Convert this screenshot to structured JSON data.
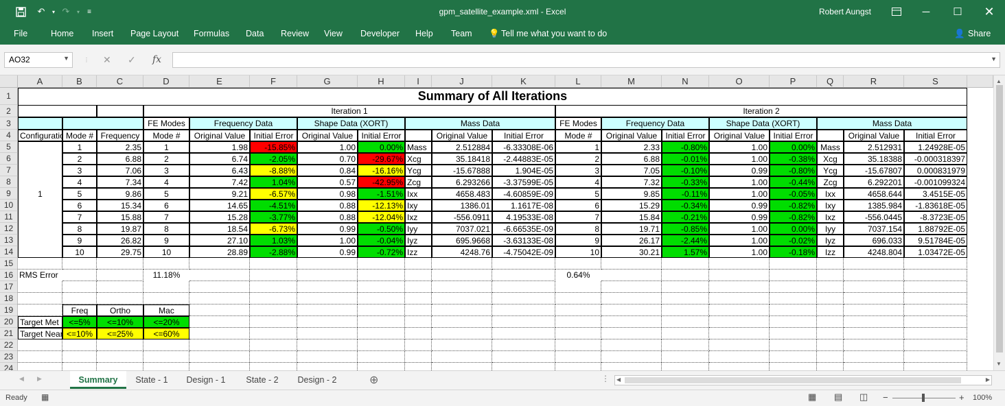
{
  "window": {
    "title": "gpm_satellite_example.xml  -  Excel",
    "user": "Robert Aungst"
  },
  "titlebar_icons": {
    "save": "save-icon",
    "undo": "undo-icon",
    "redo": "redo-icon",
    "customize": "customize-qat-icon"
  },
  "menu": {
    "items": [
      "File",
      "Home",
      "Insert",
      "Page Layout",
      "Formulas",
      "Data",
      "Review",
      "View",
      "Developer",
      "Help",
      "Team"
    ],
    "tell_me": "Tell me what you want to do",
    "share": "Share"
  },
  "formula_bar": {
    "namebox": "AO32",
    "formula": "",
    "fx": "fx"
  },
  "columns": [
    "A",
    "B",
    "C",
    "D",
    "E",
    "F",
    "G",
    "H",
    "I",
    "J",
    "K",
    "L",
    "M",
    "N",
    "O",
    "P",
    "Q",
    "R",
    "S"
  ],
  "rows": [
    "1",
    "2",
    "3",
    "4",
    "5",
    "6",
    "7",
    "8",
    "9",
    "10",
    "11",
    "12",
    "13",
    "14",
    "15",
    "16",
    "17",
    "18",
    "19",
    "20",
    "21",
    "22",
    "23",
    "24"
  ],
  "sheet": {
    "title": "Summary of All Iterations",
    "iteration1": "Iteration 1",
    "iteration2": "Iteration 2",
    "fe_modes": "FE Modes",
    "frequency_data": "Frequency Data",
    "shape_data": "Shape Data (XORT)",
    "mass_data": "Mass Data",
    "hdr_configuration": "Configuration",
    "hdr_mode": "Mode #",
    "hdr_frequency": "Frequency",
    "hdr_original": "Original Value",
    "hdr_initial_error": "Initial Error",
    "config_value": "1",
    "modes": [
      "1",
      "2",
      "3",
      "4",
      "5",
      "6",
      "7",
      "8",
      "9",
      "10"
    ],
    "frequencies": [
      "2.35",
      "6.88",
      "7.06",
      "7.34",
      "9.86",
      "15.34",
      "15.88",
      "19.87",
      "26.82",
      "29.75"
    ],
    "it1": {
      "freq_orig": [
        "1.98",
        "6.74",
        "6.43",
        "7.42",
        "9.21",
        "14.65",
        "15.28",
        "18.54",
        "27.10",
        "28.89"
      ],
      "freq_err": [
        "-15.85%",
        "-2.05%",
        "-8.88%",
        "1.04%",
        "-6.57%",
        "-4.51%",
        "-3.77%",
        "-6.73%",
        "1.03%",
        "-2.88%"
      ],
      "freq_color": [
        "red",
        "green",
        "yellow",
        "green",
        "yellow",
        "green",
        "green",
        "yellow",
        "green",
        "green"
      ],
      "shape_orig": [
        "1.00",
        "0.70",
        "0.84",
        "0.57",
        "0.98",
        "0.88",
        "0.88",
        "0.99",
        "1.00",
        "0.99"
      ],
      "shape_err": [
        "0.00%",
        "-29.67%",
        "-16.16%",
        "-42.95%",
        "-1.51%",
        "-12.13%",
        "-12.04%",
        "-0.50%",
        "-0.04%",
        "-0.72%"
      ],
      "shape_color": [
        "green",
        "red",
        "yellow",
        "red",
        "green",
        "yellow",
        "yellow",
        "green",
        "green",
        "green"
      ],
      "mass_labels": [
        "Mass",
        "Xcg",
        "Ycg",
        "Zcg",
        "Ixx",
        "Ixy",
        "Ixz",
        "Iyy",
        "Iyz",
        "Izz"
      ],
      "mass_orig": [
        "2.512884",
        "35.18418",
        "-15.67888",
        "6.293266",
        "4658.483",
        "1386.01",
        "-556.0911",
        "7037.021",
        "695.9668",
        "4248.76"
      ],
      "mass_err": [
        "-6.33308E-06",
        "-2.44883E-05",
        "1.904E-05",
        "-3.37599E-05",
        "-4.60859E-09",
        "1.1617E-08",
        "4.19533E-08",
        "-6.66535E-09",
        "-3.63133E-08",
        "-4.75042E-09"
      ]
    },
    "it2": {
      "freq_orig": [
        "2.33",
        "6.88",
        "7.05",
        "7.32",
        "9.85",
        "15.29",
        "15.84",
        "19.71",
        "26.17",
        "30.21"
      ],
      "freq_err": [
        "-0.80%",
        "-0.01%",
        "-0.10%",
        "-0.33%",
        "-0.11%",
        "-0.34%",
        "-0.21%",
        "-0.85%",
        "-2.44%",
        "1.57%"
      ],
      "shape_orig": [
        "1.00",
        "1.00",
        "0.99",
        "1.00",
        "1.00",
        "0.99",
        "0.99",
        "1.00",
        "1.00",
        "1.00"
      ],
      "shape_err": [
        "0.00%",
        "-0.38%",
        "-0.80%",
        "-0.44%",
        "-0.05%",
        "-0.82%",
        "-0.82%",
        "0.00%",
        "-0.02%",
        "-0.18%"
      ],
      "mass_labels": [
        "Mass",
        "Xcg",
        "Ycg",
        "Zcg",
        "Ixx",
        "Ixy",
        "Ixz",
        "Iyy",
        "Iyz",
        "Izz"
      ],
      "mass_orig": [
        "2.512931",
        "35.18388",
        "-15.67807",
        "6.292201",
        "4658.644",
        "1385.984",
        "-556.0445",
        "7037.154",
        "696.033",
        "4248.804"
      ],
      "mass_err": [
        "1.24928E-05",
        "-0.000318397",
        "0.000831979",
        "-0.001099324",
        "3.4515E-05",
        "-1.83618E-05",
        "-8.3723E-05",
        "1.88792E-05",
        "9.51784E-05",
        "1.03472E-05"
      ]
    },
    "rms_label": "RMS Error",
    "rms_it1": "11.18%",
    "rms_it2": "0.64%",
    "legend": {
      "freq": "Freq",
      "ortho": "Ortho",
      "mac": "Mac",
      "target_met": "Target Met",
      "target_near": "Target Near",
      "met_freq": "<=5%",
      "met_ortho": "<=10%",
      "met_mac": "<=20%",
      "near_freq": "<=10%",
      "near_ortho": "<=25%",
      "near_mac": "<=60%"
    }
  },
  "tabs": [
    "Summary",
    "State - 1",
    "Design - 1",
    "State - 2",
    "Design - 2"
  ],
  "status": {
    "ready": "Ready",
    "zoom": "100%"
  },
  "colors": {
    "excel_green": "#217346",
    "cyan": "#ccffff",
    "red": "#ff0000",
    "green": "#00dd00",
    "yellow": "#ffff00"
  }
}
